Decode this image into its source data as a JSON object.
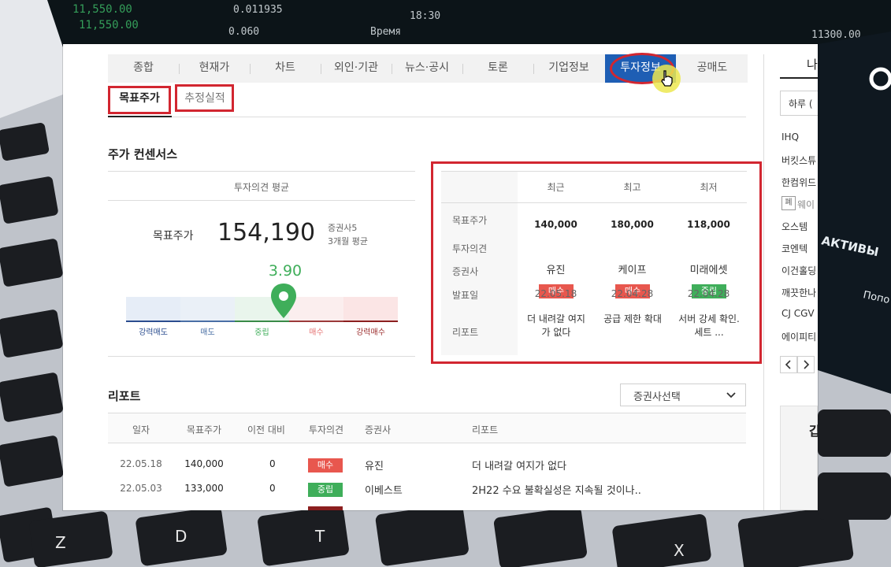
{
  "background": {
    "ticker_values": [
      "11,550.00",
      "0.011935",
      "0.060",
      "18:30",
      "Время",
      "11300.00"
    ],
    "ticker_overlay_text": [
      "АКТИВЫ",
      "Попо"
    ],
    "key_labels": [
      "D",
      "T",
      "Z",
      "X"
    ]
  },
  "nav": {
    "tabs": [
      "종합",
      "현재가",
      "차트",
      "외인·기관",
      "뉴스·공시",
      "토론",
      "기업정보",
      "투자정보",
      "공매도"
    ],
    "active_index": 7
  },
  "subtabs": [
    "목표주가",
    "추정실적"
  ],
  "consensus": {
    "title": "주가 컨센서스",
    "avg_label": "투자의견 평균",
    "target_label": "목표주가",
    "target_value": "154,190",
    "broker_count": "증권사5",
    "period": "3개월 평균",
    "score": "3.90",
    "scale_labels": [
      "강력매도",
      "매도",
      "중립",
      "매수",
      "강력매수"
    ],
    "scale_colors": [
      "#2b4d8f",
      "#6f90bd",
      "#4caf50",
      "#e57373",
      "#9b2c2c"
    ],
    "score_fraction": 0.58
  },
  "summary_table": {
    "columns": [
      "최근",
      "최고",
      "최저"
    ],
    "rows": [
      {
        "label": "목표주가",
        "values": [
          "140,000",
          "180,000",
          "118,000"
        ]
      },
      {
        "label": "투자의견",
        "values": [
          "매수",
          "매수",
          "중립"
        ]
      },
      {
        "label": "증권사",
        "values": [
          "유진",
          "케이프",
          "미래에셋"
        ]
      },
      {
        "label": "발표일",
        "values": [
          "22.05.18",
          "22.04.28",
          "22.04.28"
        ]
      },
      {
        "label": "리포트",
        "values": [
          "더 내려갈 여지가 없다",
          "공급 제한 확대",
          "서버 강세 확인. 세트 ..."
        ]
      }
    ]
  },
  "report": {
    "title": "리포트",
    "broker_select": "증권사선택",
    "columns": [
      "일자",
      "목표주가",
      "이전 대비",
      "투자의견",
      "증권사",
      "리포트"
    ],
    "rows": [
      {
        "date": "22.05.18",
        "target": "140,000",
        "diff": "0",
        "opinion": "매수",
        "broker": "유진",
        "report": "더 내려갈 여지가 없다"
      },
      {
        "date": "22.05.03",
        "target": "133,000",
        "diff": "0",
        "opinion": "중립",
        "broker": "이베스트",
        "report": "2H22 수요 불확실성은 지속될 것이나.."
      }
    ]
  },
  "sidebar": {
    "header_char": "나",
    "period_select": "하루 (",
    "items": [
      "IHQ",
      "버킷스튜",
      "한컴위드",
      "웨이",
      "오스템",
      "코엔텍",
      "이건홀딩",
      "깨끗한나",
      "CJ CGV",
      "에이피티"
    ],
    "badge_char": "폐",
    "ad_char": "갑"
  },
  "colors": {
    "buy": "#e8574e",
    "neutral": "#3fae5a",
    "active_tab": "#1e5eb4",
    "highlight_red": "#d22630"
  }
}
